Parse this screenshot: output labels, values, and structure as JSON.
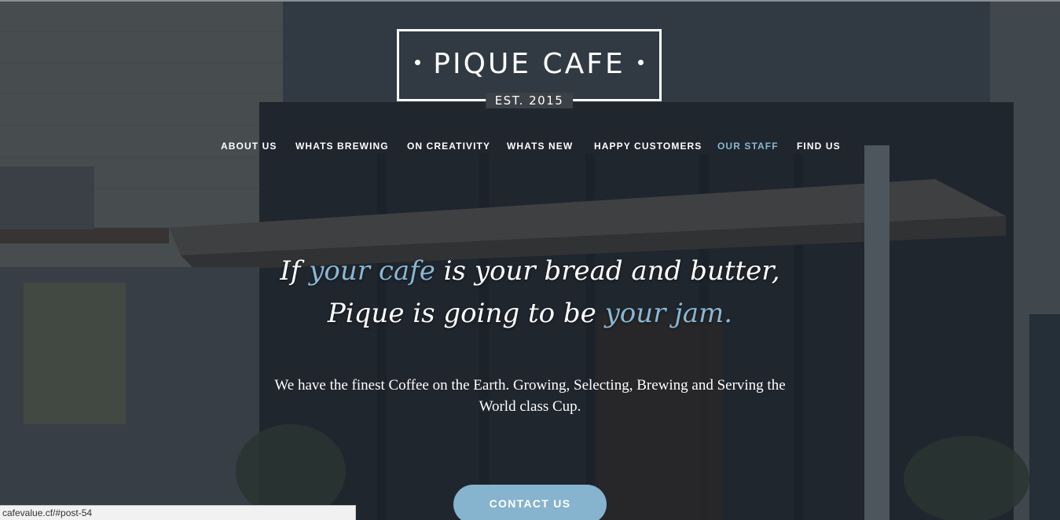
{
  "logo": {
    "title": "PIQUE CAFE",
    "established": "EST. 2015"
  },
  "nav": {
    "items": [
      {
        "label": "ABOUT US",
        "active": false
      },
      {
        "label": "WHATS BREWING",
        "active": false
      },
      {
        "label": "ON CREATIVITY",
        "active": false
      },
      {
        "label": "WHATS NEW",
        "active": false
      },
      {
        "label": "HAPPY CUSTOMERS",
        "active": false
      },
      {
        "label": "OUR STAFF",
        "active": true
      },
      {
        "label": "FIND US",
        "active": false
      }
    ]
  },
  "hero": {
    "line1_before": "If ",
    "line1_accent": "your cafe",
    "line1_after": " is your bread and butter,",
    "line2_before": "Pique is going to be ",
    "line2_accent": "your jam.",
    "description": "We have the finest Coffee on the Earth. Growing, Selecting, Brewing and Serving the World class Cup.",
    "cta_label": "CONTACT US"
  },
  "status_bar": {
    "url": "cafevalue.cf/#post-54"
  },
  "colors": {
    "accent": "#8ab7d2",
    "button": "#86b3cd",
    "overlay": "#1c222a",
    "text": "#ffffff"
  }
}
